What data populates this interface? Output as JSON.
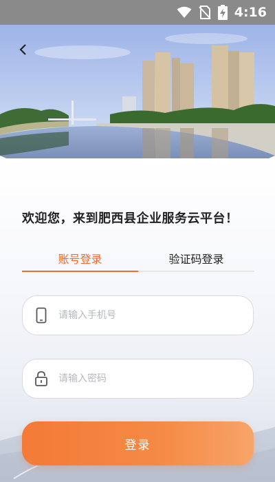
{
  "status_bar": {
    "time": "4:16"
  },
  "welcome": "欢迎您，来到肥西县企业服务云平台！",
  "tabs": [
    {
      "label": "账号登录",
      "active": true
    },
    {
      "label": "验证码登录",
      "active": false
    }
  ],
  "phone_field": {
    "placeholder": "请输入手机号",
    "value": ""
  },
  "password_field": {
    "placeholder": "请输入密码",
    "value": ""
  },
  "login_button": {
    "label": "登录"
  },
  "colors": {
    "accent": "#ee6b2b",
    "button_start": "#f47a37",
    "button_end": "#f7a46a"
  },
  "icons": {
    "back": "chevron-left-icon",
    "wifi": "wifi-icon",
    "no_sim": "no-sim-icon",
    "battery": "battery-charging-icon",
    "phone": "phone-icon",
    "lock": "lock-icon"
  }
}
